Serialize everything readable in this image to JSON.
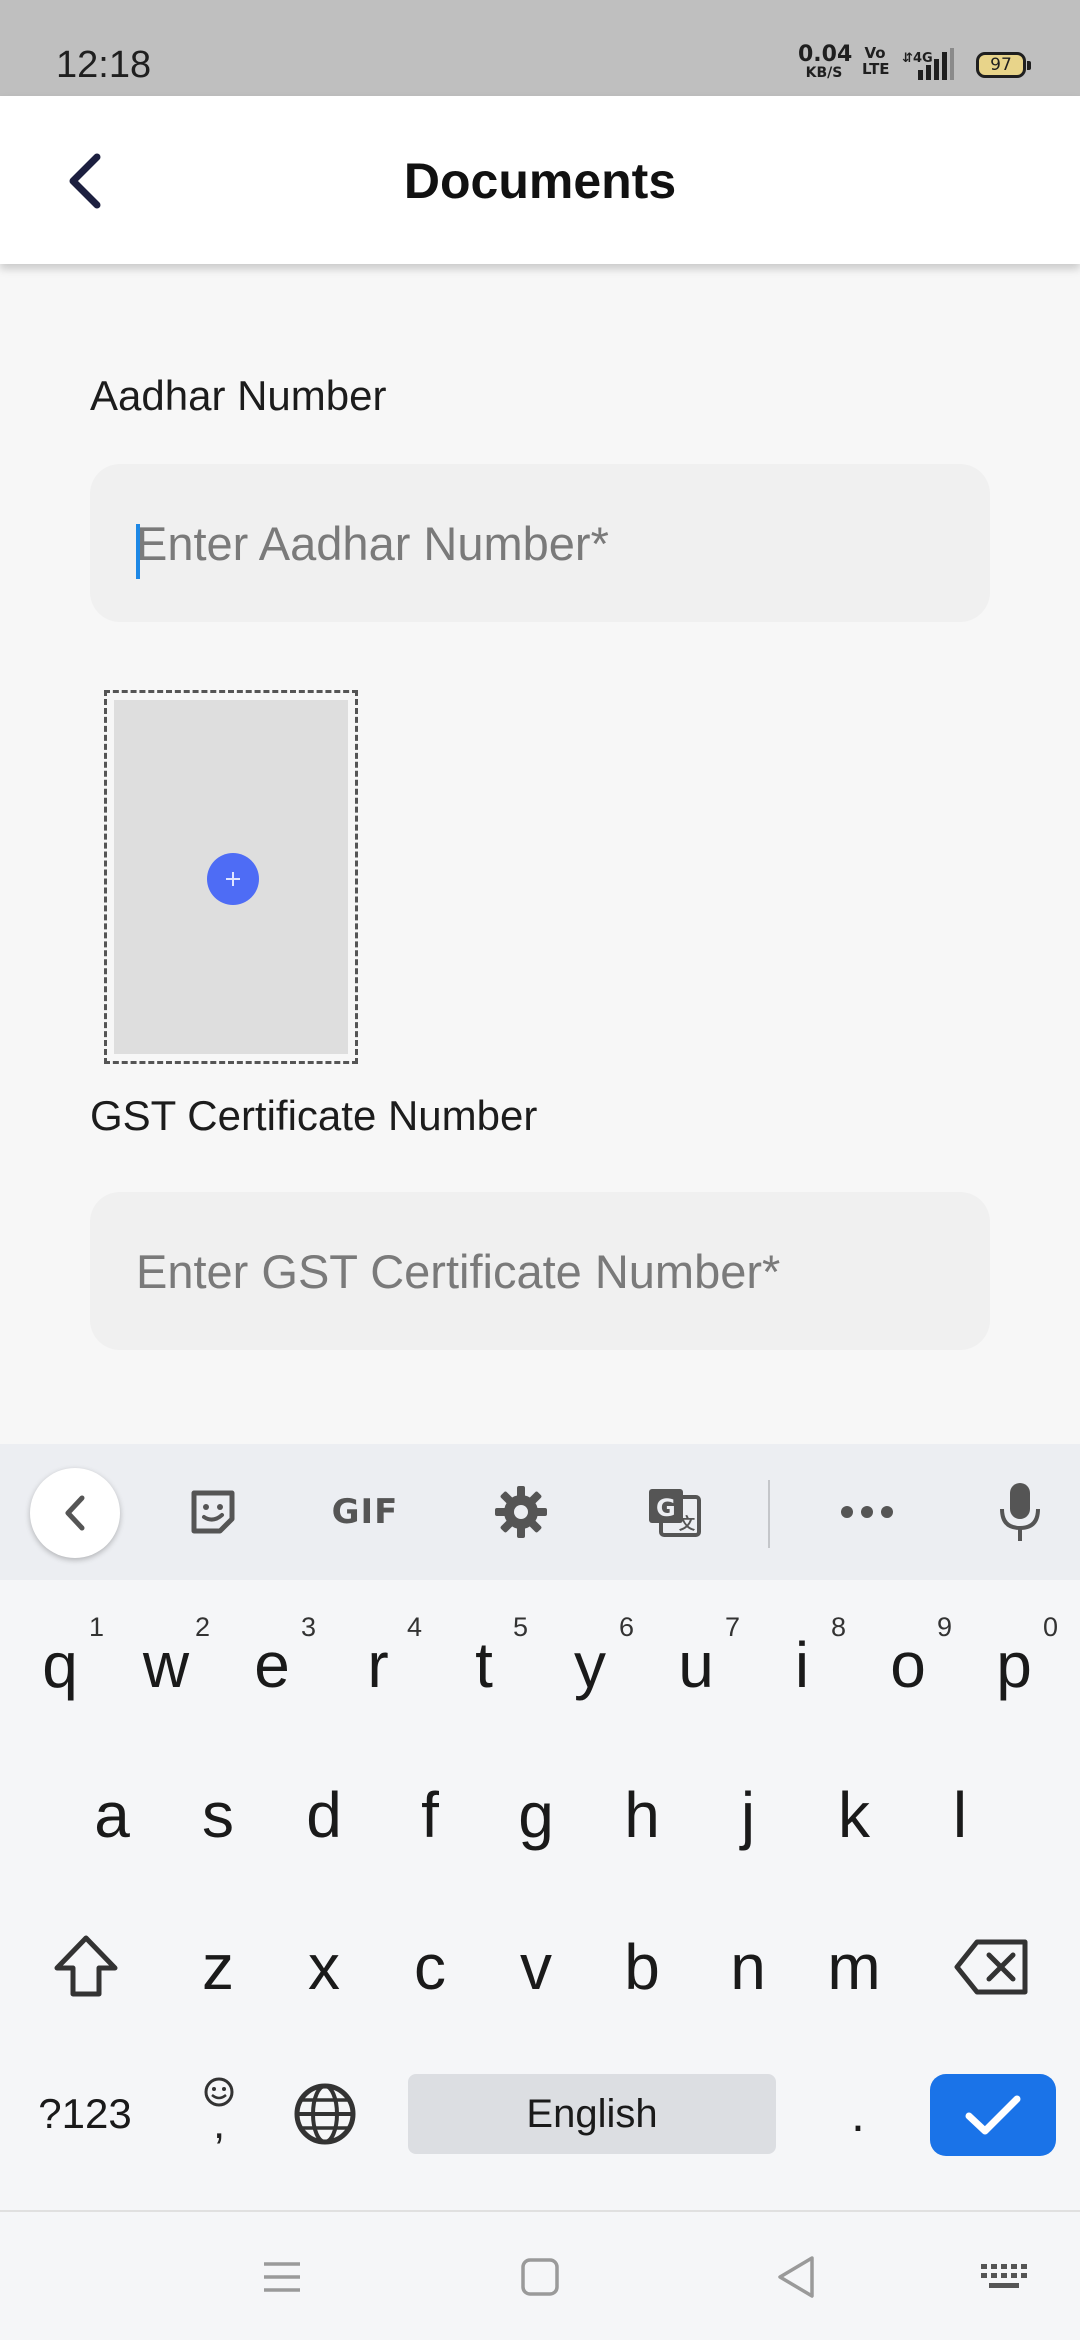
{
  "status_bar": {
    "time": "12:18",
    "net_speed_value": "0.04",
    "net_speed_unit": "KB/S",
    "volte_line1": "Vo",
    "volte_line2": "LTE",
    "network": "4G",
    "battery": "97"
  },
  "app_bar": {
    "title": "Documents",
    "back_icon": "chevron-left-icon"
  },
  "form": {
    "aadhar": {
      "label": "Aadhar Number",
      "placeholder": "Enter Aadhar Number*",
      "value": ""
    },
    "upload": {
      "icon": "plus-icon",
      "accent": "#4e6cf5"
    },
    "gst": {
      "label": "GST Certificate Number",
      "placeholder": "Enter GST Certificate Number*",
      "value": ""
    }
  },
  "keyboard": {
    "toolbar": {
      "gif_label": "GIF",
      "icons": [
        "chevron-left-icon",
        "sticker-icon",
        "gif-icon",
        "gear-icon",
        "translate-icon",
        "more-icon",
        "mic-icon"
      ]
    },
    "row1": [
      {
        "key": "q",
        "hint": "1"
      },
      {
        "key": "w",
        "hint": "2"
      },
      {
        "key": "e",
        "hint": "3"
      },
      {
        "key": "r",
        "hint": "4"
      },
      {
        "key": "t",
        "hint": "5"
      },
      {
        "key": "y",
        "hint": "6"
      },
      {
        "key": "u",
        "hint": "7"
      },
      {
        "key": "i",
        "hint": "8"
      },
      {
        "key": "o",
        "hint": "9"
      },
      {
        "key": "p",
        "hint": "0"
      }
    ],
    "row2": [
      "a",
      "s",
      "d",
      "f",
      "g",
      "h",
      "j",
      "k",
      "l"
    ],
    "row3": [
      "z",
      "x",
      "c",
      "v",
      "b",
      "n",
      "m"
    ],
    "symbols_label": "?123",
    "comma_label": ",",
    "space_label": "English",
    "period_label": ".",
    "accent": "#1a73e8"
  },
  "nav_bar": {
    "icons": [
      "menu-icon",
      "home-square-icon",
      "back-triangle-icon",
      "keyboard-icon"
    ]
  }
}
